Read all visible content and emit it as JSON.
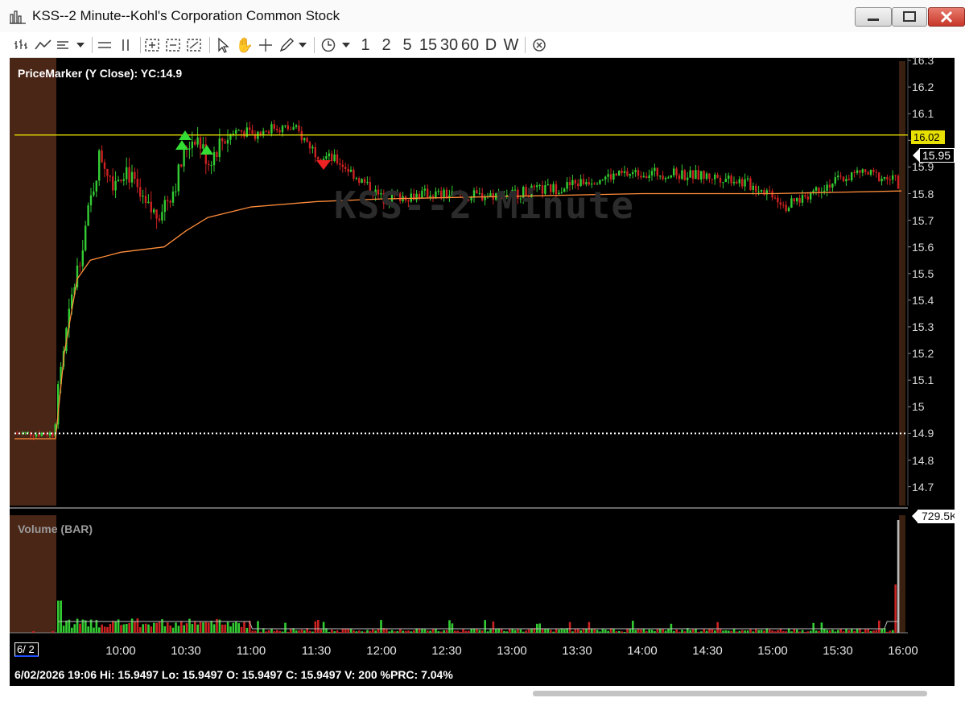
{
  "window": {
    "title": "KSS--2 Minute--Kohl's Corporation Common Stock",
    "icons": [
      "bar-chart-app-icon",
      "minimize-icon",
      "maximize-icon",
      "close-icon"
    ]
  },
  "toolbar": {
    "icons": [
      "chart-type-bars-icon",
      "chart-type-line-icon",
      "chart-style-icon",
      "dropdown-icon",
      "horizontal-split-icon",
      "vertical-split-icon",
      "zoom-in-icon",
      "zoom-fit-icon",
      "zoom-box-icon",
      "pointer-icon",
      "hand-icon",
      "crosshair-icon",
      "pencil-icon",
      "dropdown-icon",
      "clock-icon",
      "dropdown-icon",
      "close-circle-icon"
    ],
    "timeframes": [
      "1",
      "2",
      "5",
      "15",
      "30",
      "60",
      "D",
      "W"
    ]
  },
  "chart": {
    "watermark": "KSS--2 Minute",
    "price_marker_label": "PriceMarker (Y Close): YC:14.9",
    "volume_label": "Volume (BAR)",
    "price_ticks": [
      "16.3",
      "16.2",
      "16.1",
      "16",
      "15.9",
      "15.8",
      "15.7",
      "15.6",
      "15.5",
      "15.4",
      "15.3",
      "15.2",
      "15.1",
      "15",
      "14.9",
      "14.8",
      "14.7"
    ],
    "price_tag_level": "16.02",
    "last_price_tag": "15.95",
    "volume_max_tag": "729.5K",
    "date_box": "6/ 2",
    "time_labels": [
      "10:00",
      "10:30",
      "11:00",
      "11:30",
      "12:00",
      "12:30",
      "13:00",
      "13:30",
      "14:00",
      "14:30",
      "15:00",
      "15:30",
      "16:00"
    ],
    "status_line": "6/02/2026 19:06  Hi: 15.9497  Lo: 15.9497  O: 15.9497  C: 15.9497  V: 200 %PRC: 7.04%",
    "colors": {
      "background": "#000000",
      "up": "#33cc33",
      "down": "#cc2222",
      "level_line": "#e8e000",
      "vwap": "#ff8c3a",
      "premarket_shade": "#4a2616",
      "prev_close_line": "#ffffff"
    }
  },
  "chart_data": {
    "type": "candlestick",
    "title": "KSS--2 Minute",
    "ylim": [
      14.65,
      16.32
    ],
    "yticks": [
      14.7,
      14.8,
      14.9,
      15.0,
      15.1,
      15.2,
      15.3,
      15.4,
      15.5,
      15.6,
      15.7,
      15.8,
      15.9,
      16.0,
      16.1,
      16.2,
      16.3
    ],
    "horizontal_lines": [
      {
        "name": "Y Close",
        "value": 14.9,
        "style": "dotted"
      },
      {
        "name": "level",
        "value": 16.02,
        "style": "solid"
      }
    ],
    "last_price": 15.95,
    "time_labels": [
      "10:00",
      "10:30",
      "11:00",
      "11:30",
      "12:00",
      "12:30",
      "13:00",
      "13:30",
      "14:00",
      "14:30",
      "15:00",
      "15:30",
      "16:00"
    ],
    "volume_max": "729.5K",
    "price_path": [
      [
        "09:00",
        14.9
      ],
      [
        "09:30",
        14.9
      ],
      [
        "09:32",
        15.15
      ],
      [
        "09:38",
        15.45
      ],
      [
        "09:44",
        15.7
      ],
      [
        "09:50",
        15.95
      ],
      [
        "09:56",
        15.85
      ],
      [
        "10:02",
        15.9
      ],
      [
        "10:10",
        15.75
      ],
      [
        "10:16",
        15.72
      ],
      [
        "10:24",
        15.82
      ],
      [
        "10:30",
        15.98
      ],
      [
        "10:34",
        16.02
      ],
      [
        "10:40",
        15.92
      ],
      [
        "10:46",
        16.0
      ],
      [
        "10:54",
        16.04
      ],
      [
        "11:00",
        16.02
      ],
      [
        "11:10",
        16.05
      ],
      [
        "11:20",
        16.04
      ],
      [
        "11:30",
        15.95
      ],
      [
        "11:40",
        15.92
      ],
      [
        "11:50",
        15.85
      ],
      [
        "12:00",
        15.78
      ],
      [
        "12:20",
        15.8
      ],
      [
        "12:40",
        15.79
      ],
      [
        "13:00",
        15.8
      ],
      [
        "13:20",
        15.82
      ],
      [
        "13:40",
        15.86
      ],
      [
        "14:00",
        15.88
      ],
      [
        "14:20",
        15.87
      ],
      [
        "14:40",
        15.86
      ],
      [
        "15:00",
        15.8
      ],
      [
        "15:06",
        15.75
      ],
      [
        "15:20",
        15.82
      ],
      [
        "15:40",
        15.88
      ],
      [
        "15:56",
        15.85
      ],
      [
        "15:58",
        15.78
      ],
      [
        "16:00",
        15.95
      ]
    ],
    "vwap_path": [
      [
        "09:00",
        14.88
      ],
      [
        "09:30",
        14.88
      ],
      [
        "09:34",
        15.2
      ],
      [
        "09:40",
        15.48
      ],
      [
        "09:46",
        15.55
      ],
      [
        "10:00",
        15.58
      ],
      [
        "10:20",
        15.6
      ],
      [
        "10:30",
        15.66
      ],
      [
        "10:40",
        15.71
      ],
      [
        "11:00",
        15.75
      ],
      [
        "11:30",
        15.77
      ],
      [
        "12:00",
        15.78
      ],
      [
        "13:00",
        15.79
      ],
      [
        "14:00",
        15.8
      ],
      [
        "15:00",
        15.8
      ],
      [
        "16:00",
        15.81
      ]
    ]
  }
}
